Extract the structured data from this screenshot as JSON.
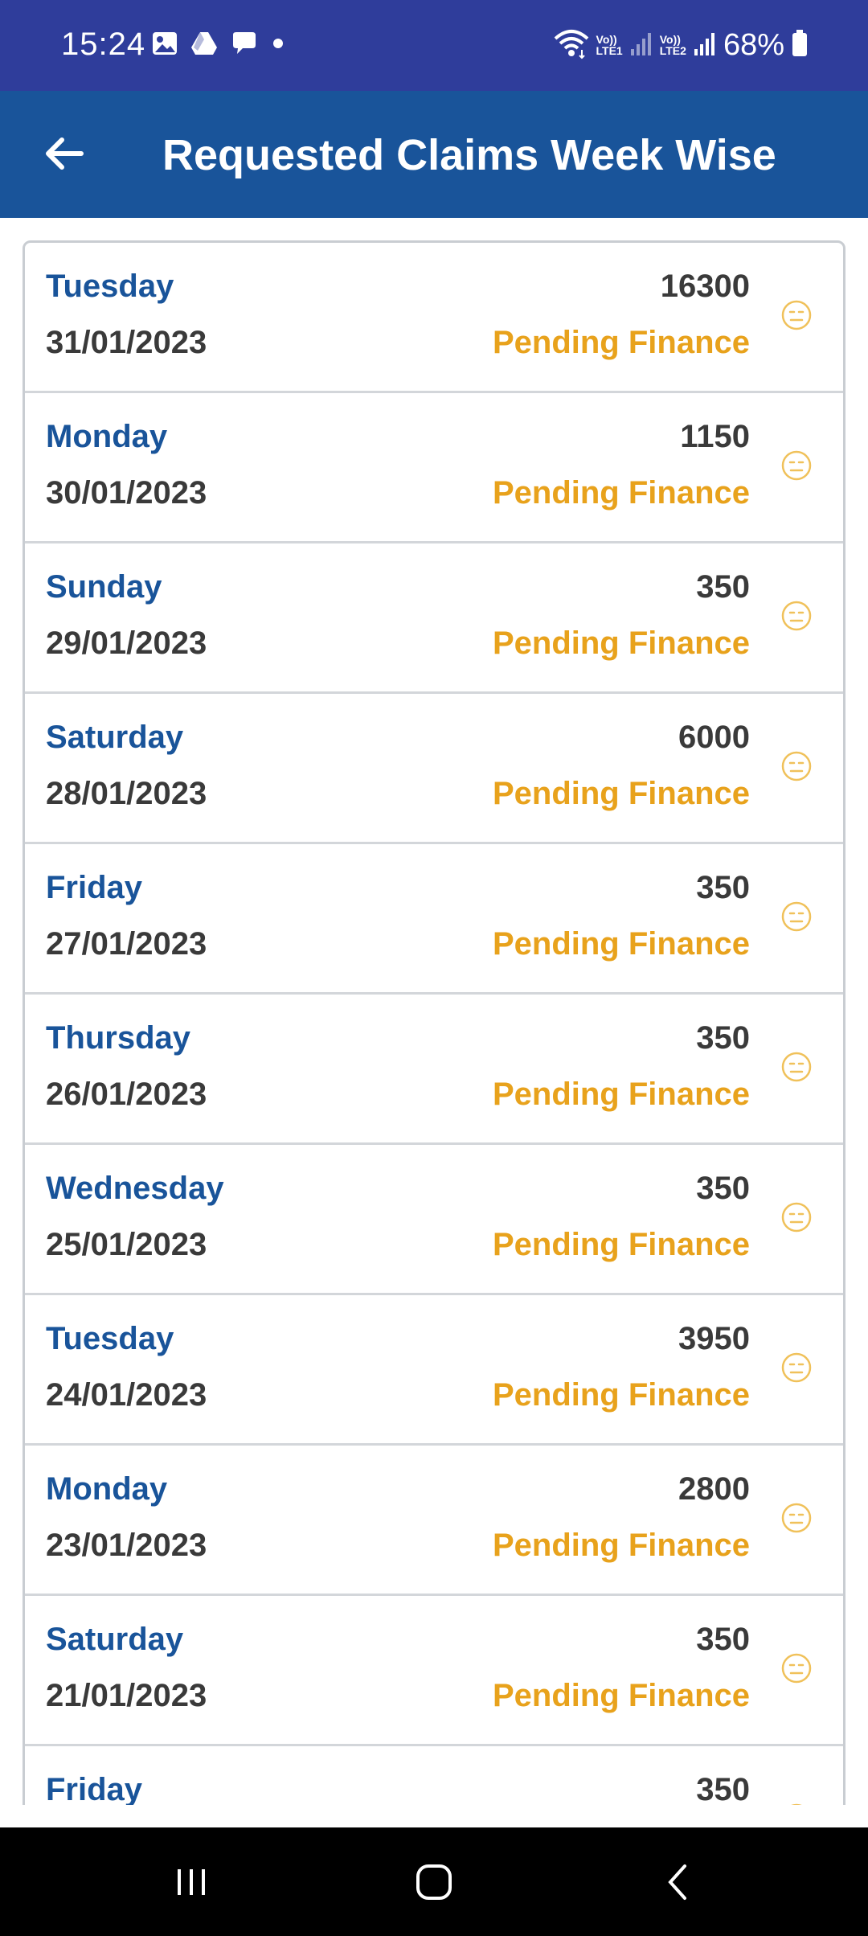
{
  "status_bar": {
    "time": "15:24",
    "battery": "68%",
    "sim1": {
      "top": "Vo))",
      "bottom": "LTE1"
    },
    "sim2": {
      "top": "Vo))",
      "bottom": "LTE2"
    }
  },
  "header": {
    "title": "Requested Claims Week Wise"
  },
  "claims": [
    {
      "day": "Tuesday",
      "date": "31/01/2023",
      "amount": "16300",
      "status": "Pending Finance"
    },
    {
      "day": "Monday",
      "date": "30/01/2023",
      "amount": "1150",
      "status": "Pending Finance"
    },
    {
      "day": "Sunday",
      "date": "29/01/2023",
      "amount": "350",
      "status": "Pending Finance"
    },
    {
      "day": "Saturday",
      "date": "28/01/2023",
      "amount": "6000",
      "status": "Pending Finance"
    },
    {
      "day": "Friday",
      "date": "27/01/2023",
      "amount": "350",
      "status": "Pending Finance"
    },
    {
      "day": "Thursday",
      "date": "26/01/2023",
      "amount": "350",
      "status": "Pending Finance"
    },
    {
      "day": "Wednesday",
      "date": "25/01/2023",
      "amount": "350",
      "status": "Pending Finance"
    },
    {
      "day": "Tuesday",
      "date": "24/01/2023",
      "amount": "3950",
      "status": "Pending Finance"
    },
    {
      "day": "Monday",
      "date": "23/01/2023",
      "amount": "2800",
      "status": "Pending Finance"
    },
    {
      "day": "Saturday",
      "date": "21/01/2023",
      "amount": "350",
      "status": "Pending Finance"
    },
    {
      "day": "Friday",
      "date": "",
      "amount": "350",
      "status": ""
    }
  ],
  "icons": {
    "back": "arrow-left-icon",
    "row_status": "neutral-face-icon",
    "nav_recents": "recents-icon",
    "nav_home": "home-icon",
    "nav_back": "back-chevron-icon"
  },
  "colors": {
    "status_bar": "#2f3d9b",
    "header": "#19549a",
    "day_text": "#19549a",
    "pending_text": "#e8a21c"
  }
}
